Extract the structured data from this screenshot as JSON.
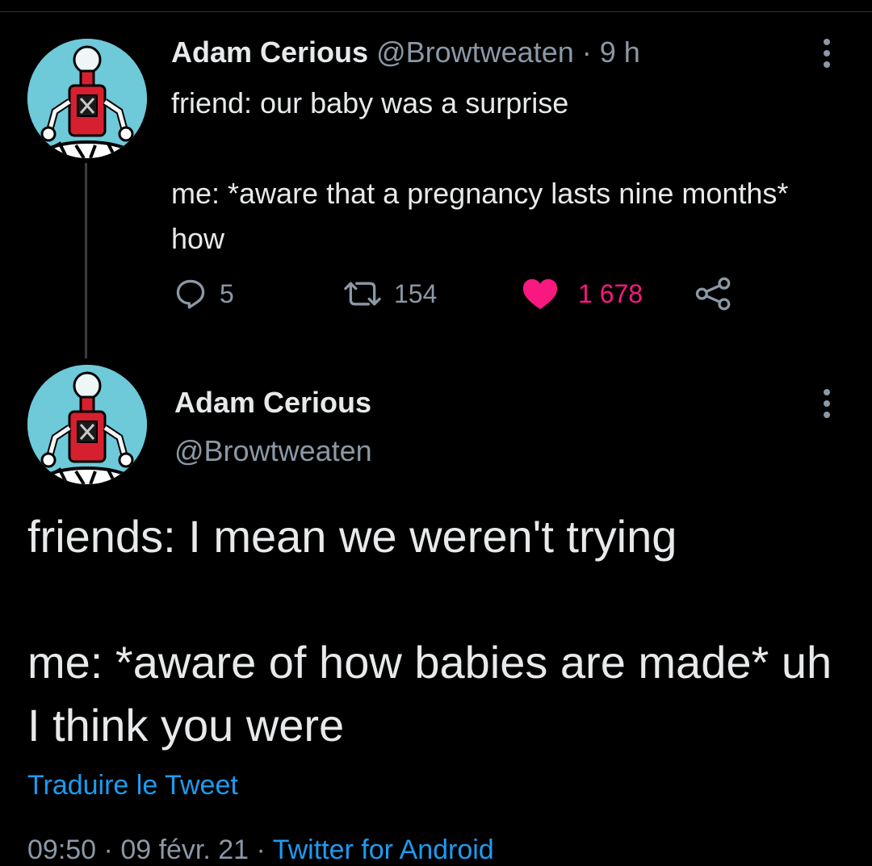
{
  "colors": {
    "background": "#000000",
    "text": "#e7e9ea",
    "muted": "#8b98a5",
    "like": "#f91880",
    "link": "#1d9bf0"
  },
  "tweet1": {
    "author_name": "Adam Cerious",
    "author_handle": "@Browtweaten",
    "separator": "·",
    "time": "9 h",
    "text": "friend: our baby was a surprise\n\nme: *aware that a pregnancy lasts nine months* how",
    "actions": {
      "reply_icon": "reply-icon",
      "replies": "5",
      "retweet_icon": "retweet-icon",
      "retweets": "154",
      "like_icon": "heart-filled-icon",
      "likes": "1 678",
      "liked": true,
      "share_icon": "share-icon"
    }
  },
  "tweet2": {
    "author_name": "Adam Cerious",
    "author_handle": "@Browtweaten",
    "text": "friends: I mean we weren't trying\n\nme: *aware of how babies are made* uh I think you were",
    "translate_link": "Traduire le Tweet",
    "meta_time": "09:50",
    "meta_date": "09 févr. 21",
    "meta_app": "Twitter for Android"
  }
}
